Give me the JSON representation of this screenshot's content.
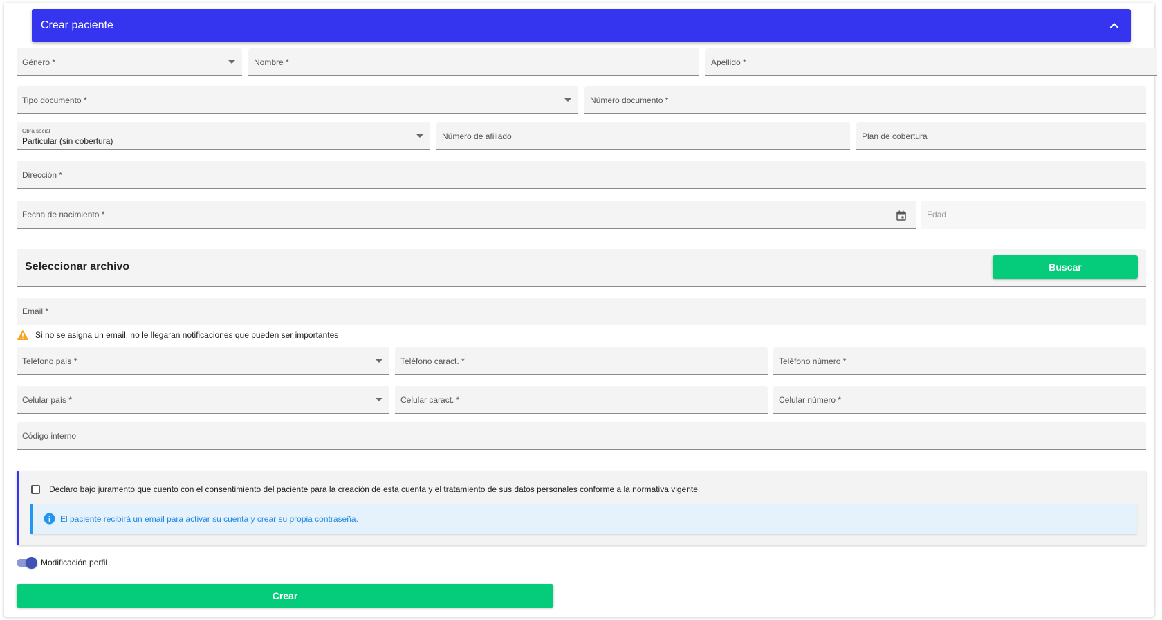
{
  "header": {
    "title": "Crear paciente",
    "collapse_icon": "chevron-up-icon"
  },
  "fields": {
    "genero": "Género *",
    "nombre": "Nombre *",
    "apellido": "Apellido *",
    "tipo_documento": "Tipo documento *",
    "numero_documento": "Número documento *",
    "obra_social": {
      "label": "Obra social",
      "value": "Particular (sin cobertura)"
    },
    "numero_afiliado": "Número de afiliado",
    "plan_cobertura": "Plan de cobertura",
    "direccion": "Dirección *",
    "fecha_nacimiento": "Fecha de nacimiento *",
    "edad": "Edad",
    "email": "Email *",
    "telefono_pais": "Teléfono país *",
    "telefono_caract": "Teléfono caract. *",
    "telefono_numero": "Teléfono número *",
    "celular_pais": "Celular país *",
    "celular_caract": "Celular caract. *",
    "celular_numero": "Celular número *",
    "codigo_interno": "Código interno"
  },
  "file": {
    "title": "Seleccionar archivo",
    "button": "Buscar"
  },
  "warning": {
    "icon": "warning-icon",
    "text": "Si no se asigna un email, no le llegaran notificaciones que pueden ser importantes"
  },
  "consent": {
    "checked": false,
    "text": "Declaro bajo juramento que cuento con el consentimiento del paciente para la creación de esta cuenta y el tratamiento de sus datos personales conforme a la normativa vigente.",
    "info_icon": "info-icon",
    "info": "El paciente recibirá un email para activar su cuenta y crear su propia contraseña."
  },
  "toggle": {
    "label": "Modificación perfil",
    "on": true
  },
  "submit": {
    "label": "Crear"
  },
  "colors": {
    "header": "#3535ef",
    "button": "#05cc7a",
    "info_text": "#1e88e5",
    "warning": "#f5a623"
  }
}
